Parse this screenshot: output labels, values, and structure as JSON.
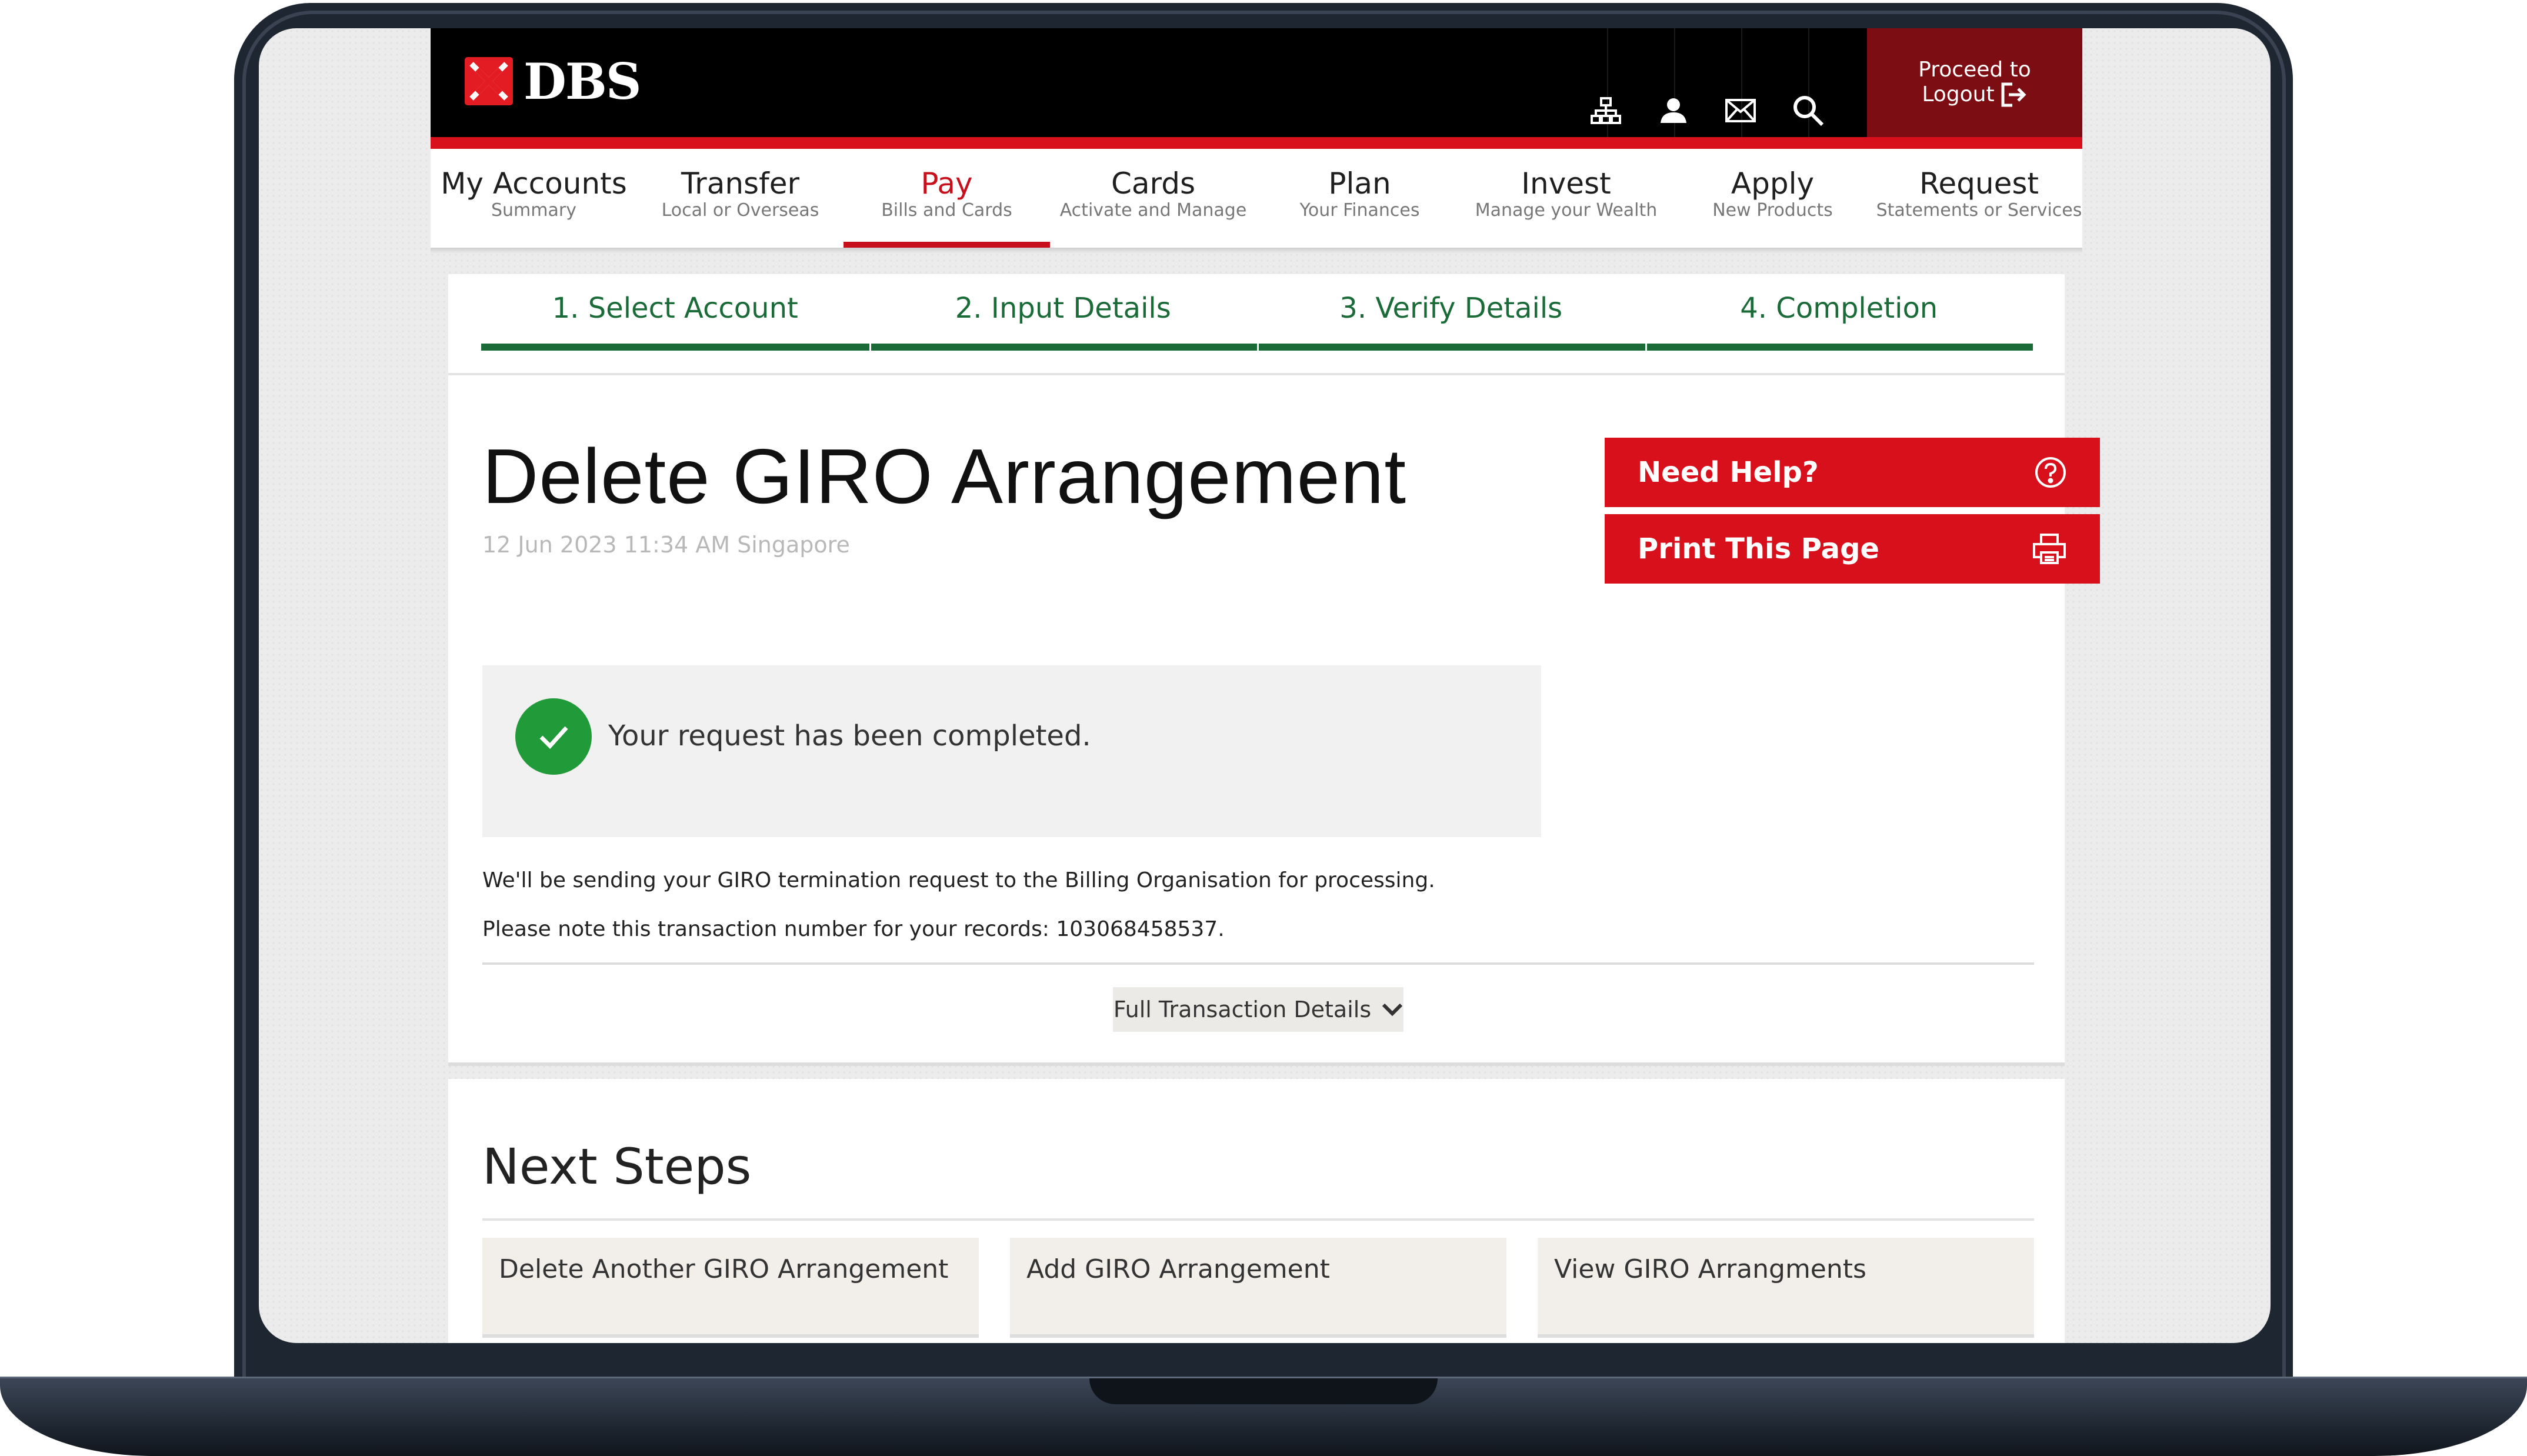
{
  "header": {
    "brand": "DBS",
    "logout_line1": "Proceed to",
    "logout_line2": "Logout",
    "icons": [
      "sitemap-icon",
      "user-icon",
      "mail-icon",
      "search-icon"
    ]
  },
  "nav": {
    "items": [
      {
        "title": "My Accounts",
        "sub": "Summary"
      },
      {
        "title": "Transfer",
        "sub": "Local or Overseas"
      },
      {
        "title": "Pay",
        "sub": "Bills and Cards"
      },
      {
        "title": "Cards",
        "sub": "Activate and Manage"
      },
      {
        "title": "Plan",
        "sub": "Your Finances"
      },
      {
        "title": "Invest",
        "sub": "Manage your Wealth"
      },
      {
        "title": "Apply",
        "sub": "New Products"
      },
      {
        "title": "Request",
        "sub": "Statements or Services"
      }
    ],
    "active": "Pay"
  },
  "steps": [
    "1. Select Account",
    "2. Input Details",
    "3. Verify Details",
    "4. Completion"
  ],
  "page": {
    "title": "Delete GIRO Arrangement",
    "date": "12 Jun 2023 11:34 AM Singapore"
  },
  "side_buttons": {
    "help": "Need Help?",
    "print": "Print This Page"
  },
  "status": {
    "message": "Your request has been completed."
  },
  "info": {
    "line1": "We'll be sending your GIRO termination request to the Billing Organisation for processing.",
    "line2": "Please note this transaction number for your records: 103068458537."
  },
  "details_toggle": "Full Transaction Details",
  "next_steps": {
    "title": "Next Steps",
    "items": [
      "Delete Another GIRO Arrangement",
      "Add GIRO Arrangement",
      "View GIRO Arrangments"
    ]
  },
  "colors": {
    "brand_red": "#d8101c",
    "logout_bg": "#7c0d12",
    "step_green": "#1b6b38",
    "success_green": "#219a3a"
  }
}
